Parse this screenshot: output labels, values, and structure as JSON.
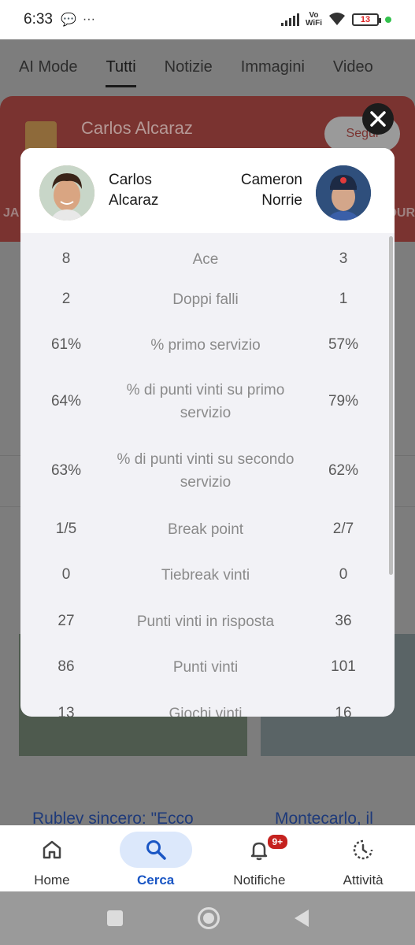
{
  "status": {
    "time": "6:33",
    "vowifi_top": "Vo",
    "vowifi_bottom": "WiFi",
    "battery": "13"
  },
  "tabs": [
    "AI Mode",
    "Tutti",
    "Notizie",
    "Immagini",
    "Video"
  ],
  "player_card": {
    "name": "Carlos Alcaraz",
    "follow": "Segui",
    "left_edge": "JA",
    "right_edge": "OUR"
  },
  "modal": {
    "left_player": {
      "first": "Carlos",
      "last": "Alcaraz"
    },
    "right_player": {
      "first": "Cameron",
      "last": "Norrie"
    },
    "stats": [
      {
        "left": "8",
        "label": "Ace",
        "right": "3"
      },
      {
        "left": "2",
        "label": "Doppi falli",
        "right": "1"
      },
      {
        "left": "61%",
        "label": "% primo servizio",
        "right": "57%"
      },
      {
        "left": "64%",
        "label": "% di punti vinti su primo servizio",
        "right": "79%"
      },
      {
        "left": "63%",
        "label": "% di punti vinti su secondo servizio",
        "right": "62%"
      },
      {
        "left": "1/5",
        "label": "Break point",
        "right": "2/7"
      },
      {
        "left": "0",
        "label": "Tiebreak vinti",
        "right": "0"
      },
      {
        "left": "27",
        "label": "Punti vinti in risposta",
        "right": "36"
      },
      {
        "left": "86",
        "label": "Punti vinti",
        "right": "101"
      },
      {
        "left": "13",
        "label": "Giochi vinti",
        "right": "16"
      }
    ]
  },
  "news": {
    "left_title": "Rublev sincero: \"Ecco perché Sinner e Alcaraz sono diversi da",
    "right_title": "Montecarlo, il tabellone: Sinner parte di Zverev"
  },
  "bottom_nav": {
    "items": [
      {
        "label": "Home",
        "icon": "home-icon"
      },
      {
        "label": "Cerca",
        "icon": "search-icon"
      },
      {
        "label": "Notifiche",
        "icon": "bell-icon"
      },
      {
        "label": "Attività",
        "icon": "activity-icon"
      }
    ],
    "badge": "9+"
  }
}
